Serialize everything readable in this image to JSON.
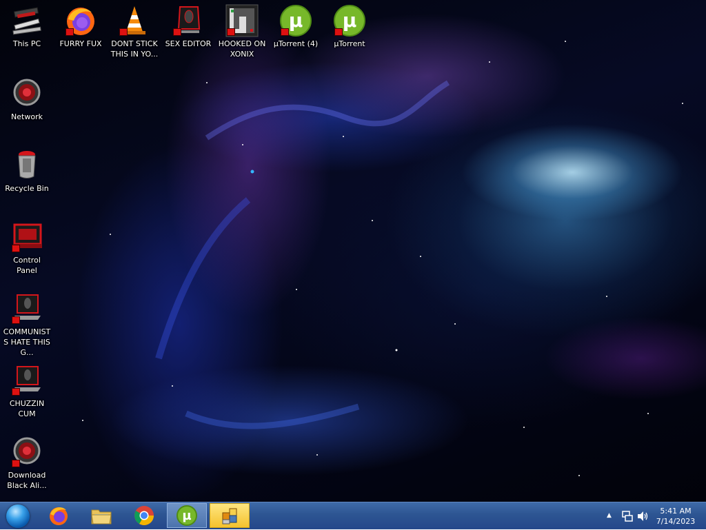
{
  "desktop": {
    "icons": [
      {
        "id": "this-pc",
        "label": "This PC",
        "icon": "computer-icon"
      },
      {
        "id": "furry-fux",
        "label": "FURRY FUX",
        "icon": "firefox-icon"
      },
      {
        "id": "dont-stick",
        "label": "DONT STICK THIS IN YO...",
        "icon": "vlc-cone-icon"
      },
      {
        "id": "sex-editor",
        "label": "SEX EDITOR",
        "icon": "alien-shield-icon"
      },
      {
        "id": "hooked-on-xonix",
        "label": "HOOKED ON XONIX",
        "icon": "xonix-game-icon"
      },
      {
        "id": "utorrent-4",
        "label": "µTorrent (4)",
        "icon": "utorrent-icon"
      },
      {
        "id": "utorrent",
        "label": "µTorrent",
        "icon": "utorrent-icon"
      },
      {
        "id": "network",
        "label": "Network",
        "icon": "network-icon"
      },
      {
        "id": "recycle-bin",
        "label": "Recycle Bin",
        "icon": "recycle-bin-icon"
      },
      {
        "id": "control-panel",
        "label": "Control Panel",
        "icon": "control-panel-icon"
      },
      {
        "id": "communists",
        "label": "COMMUNISTS HATE THIS G...",
        "icon": "alien-laptop-icon"
      },
      {
        "id": "chuzzin",
        "label": "CHUZZIN CUM",
        "icon": "alien-laptop-icon"
      },
      {
        "id": "download-black",
        "label": "Download Black Ali...",
        "icon": "alien-orb-icon"
      }
    ]
  },
  "taskbar": {
    "start_icon": "start-orb-icon",
    "pinned": [
      {
        "id": "firefox",
        "icon": "firefox-icon",
        "state": "normal"
      },
      {
        "id": "explorer",
        "icon": "folder-icon",
        "state": "normal"
      },
      {
        "id": "chrome",
        "icon": "chrome-icon",
        "state": "normal"
      },
      {
        "id": "utorrent",
        "icon": "utorrent-icon",
        "state": "active"
      },
      {
        "id": "app",
        "icon": "app-window-icon",
        "state": "highlight"
      }
    ],
    "tray": {
      "overflow_glyph": "▲",
      "network_icon": "network-tray-icon",
      "volume_icon": "volume-icon"
    },
    "clock": {
      "time": "5:41 AM",
      "date": "7/14/2023"
    }
  },
  "colors": {
    "taskbar": "#2d5592",
    "utorrent_green": "#77b82a",
    "alien_red": "#d4161b"
  }
}
